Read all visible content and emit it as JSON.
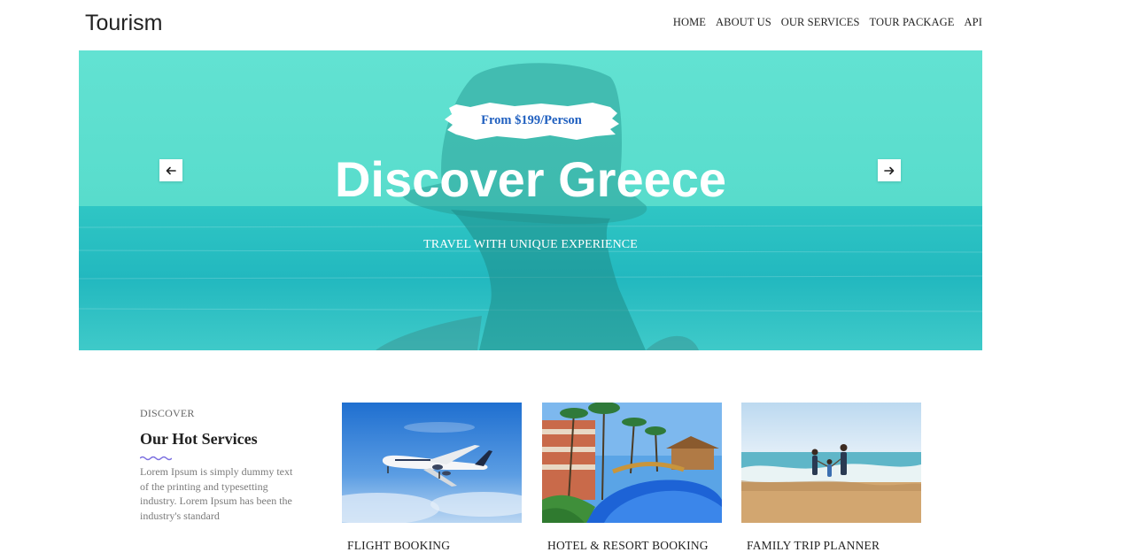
{
  "header": {
    "brand": "Tourism",
    "nav": [
      "HOME",
      "ABOUT US",
      "OUR SERVICES",
      "TOUR PACKAGE",
      "API"
    ]
  },
  "hero": {
    "price": "From $199/Person",
    "title": "Discover Greece",
    "subtitle": "TRAVEL WITH UNIQUE EXPERIENCE",
    "prev_icon": "arrow-left-icon",
    "next_icon": "arrow-right-icon",
    "overlay_color": "#48d9c7"
  },
  "services": {
    "eyebrow": "DISCOVER",
    "title": "Our Hot Services",
    "description": "Lorem Ipsum is simply dummy text of the printing and typesetting industry. Lorem Ipsum has been the industry's standard",
    "accent_color": "#7b6fe0",
    "cards": [
      {
        "label": "FLIGHT BOOKING"
      },
      {
        "label": "HOTEL & RESORT BOOKING"
      },
      {
        "label": "FAMILY TRIP PLANNER"
      }
    ]
  }
}
